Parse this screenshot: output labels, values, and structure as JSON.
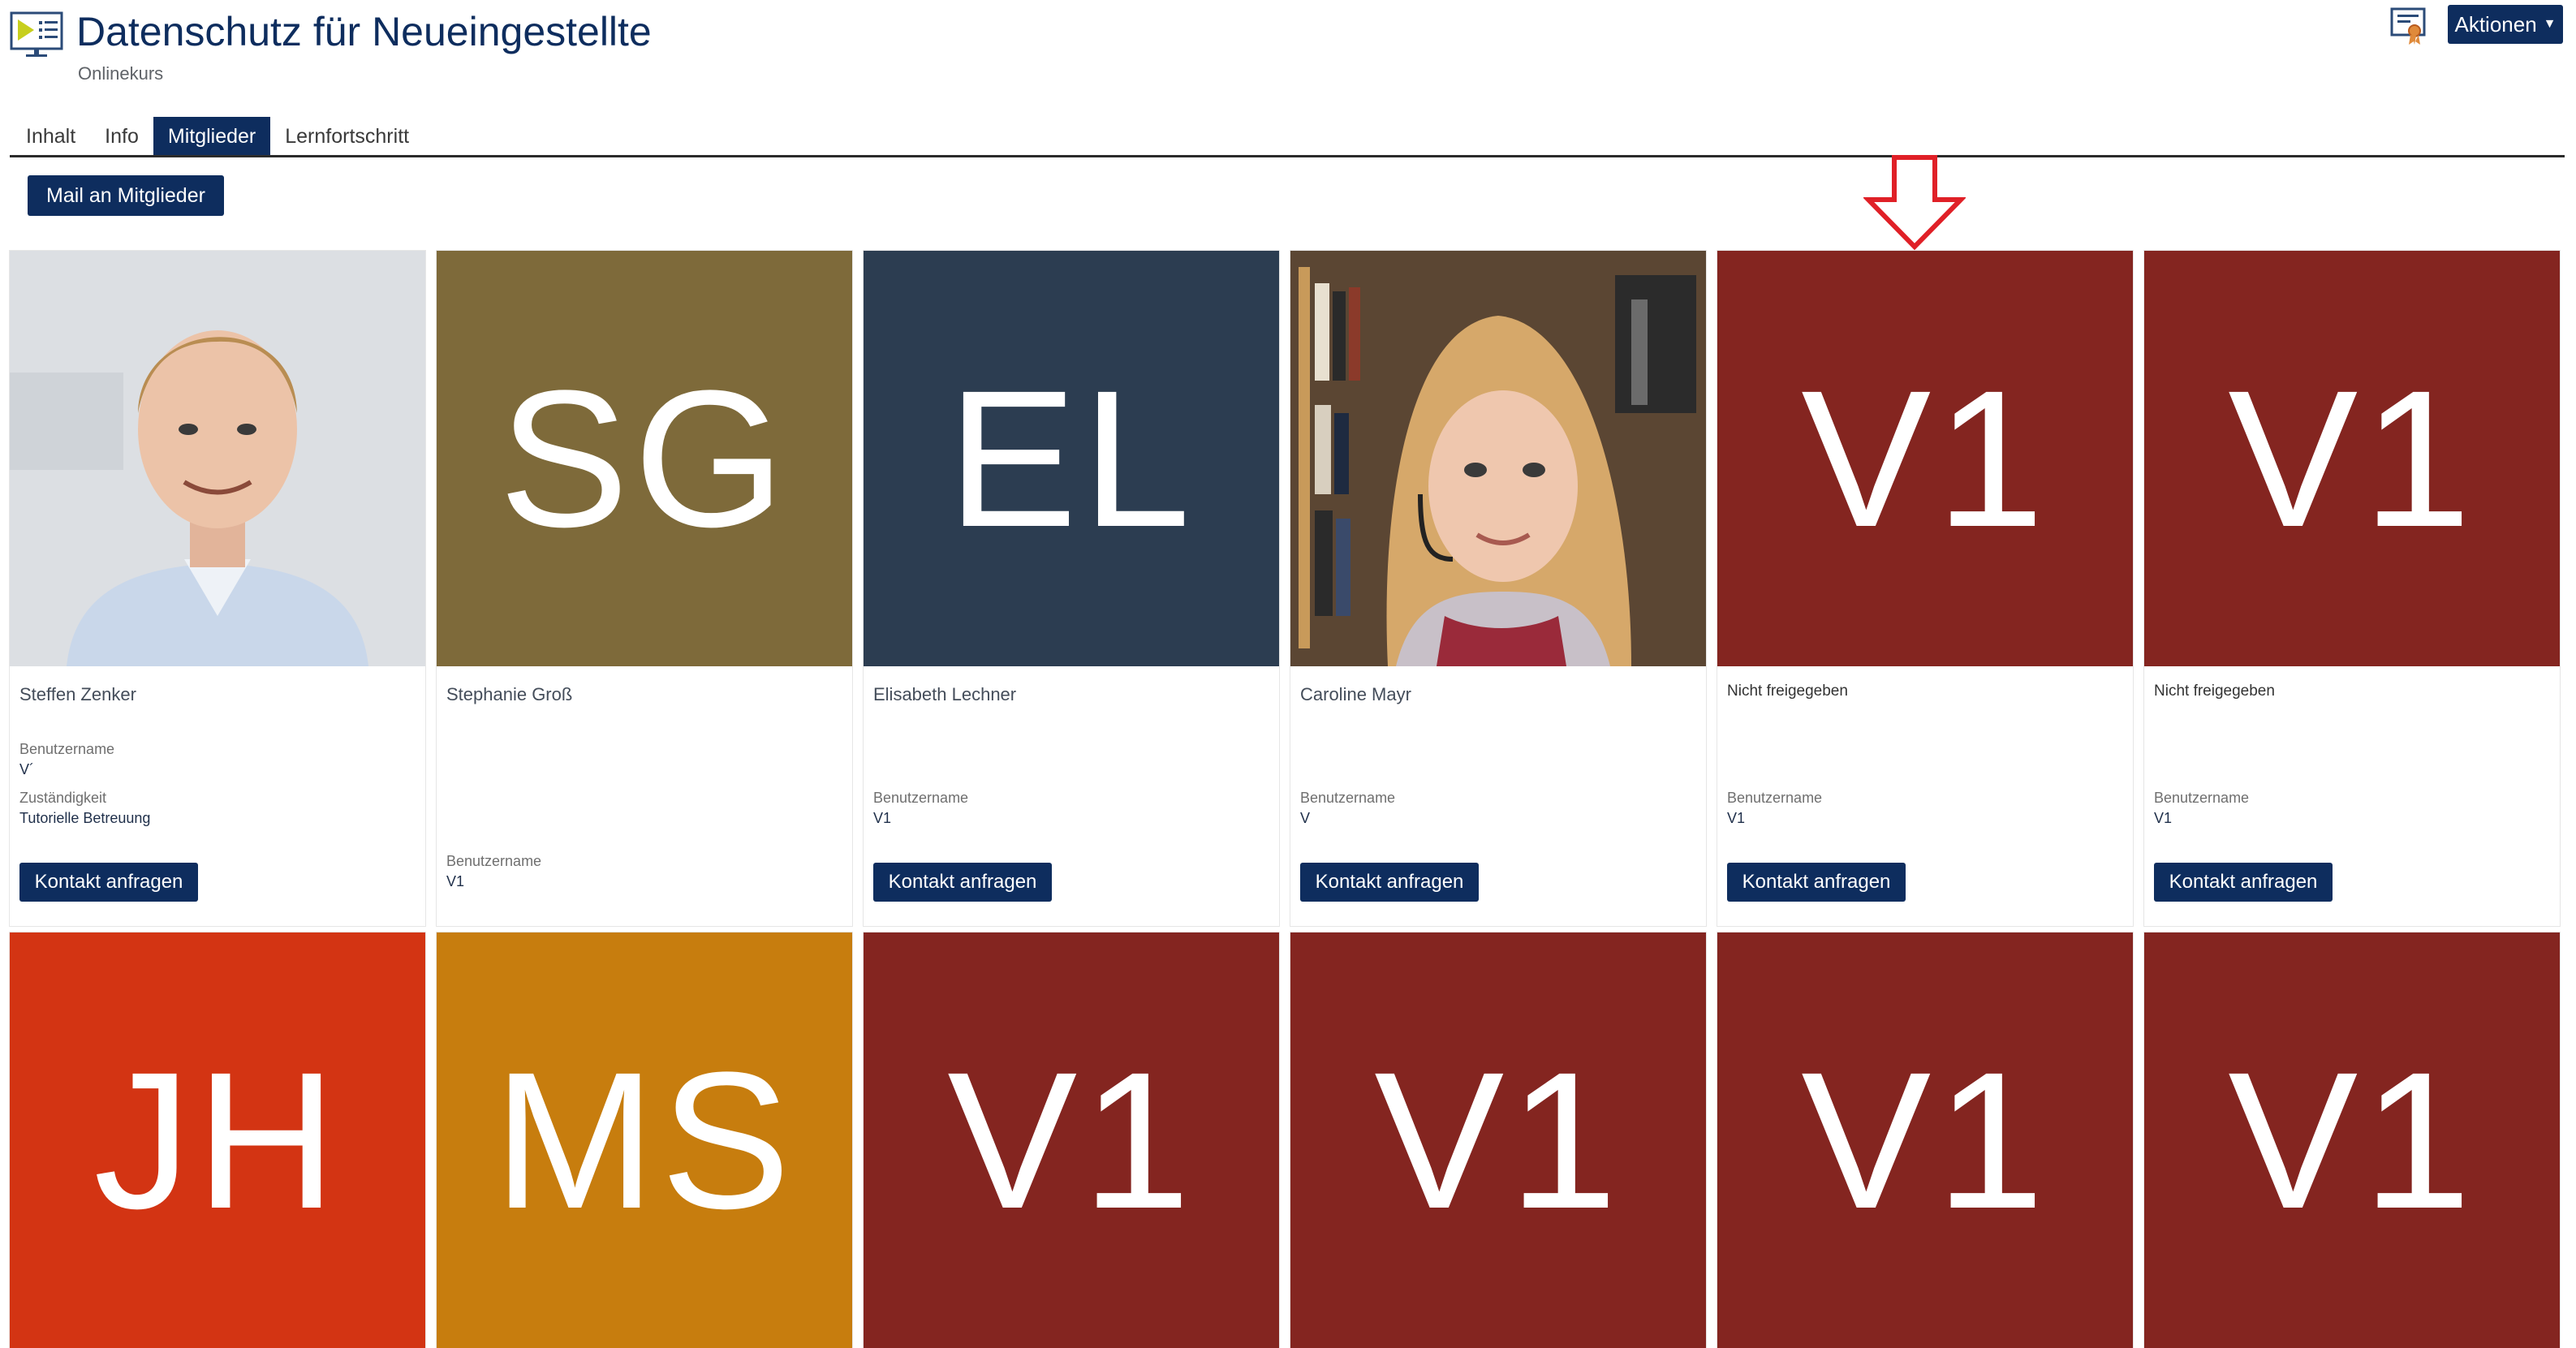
{
  "header": {
    "title": "Datenschutz für Neueingestellte",
    "subtitle": "Onlinekurs",
    "actions_label": "Aktionen",
    "course_icon": "presentation-icon",
    "certificate_icon": "certificate-icon"
  },
  "tabs": [
    {
      "label": "Inhalt",
      "active": false
    },
    {
      "label": "Info",
      "active": false
    },
    {
      "label": "Mitglieder",
      "active": true
    },
    {
      "label": "Lernfortschritt",
      "active": false
    }
  ],
  "mail_button": "Mail an Mitglieder",
  "colors": {
    "primary": "#0e2d5e",
    "annotation_arrow": "#e02027"
  },
  "members_row1": [
    {
      "name": "Steffen Zenker",
      "status": "",
      "photo": true,
      "color": "#dfe3e8",
      "username_label": "Benutzername",
      "username": "V´",
      "responsibility_label": "Zuständigkeit",
      "responsibility": "Tutorielle Betreuung",
      "contact": "Kontakt anfragen"
    },
    {
      "name": "Stephanie Groß",
      "status": "",
      "initials": "SG",
      "color": "#7e6a3a",
      "username_label": "Benutzername",
      "username": "V1",
      "contact": ""
    },
    {
      "name": "Elisabeth Lechner",
      "status": "",
      "initials": "EL",
      "color": "#2c3d51",
      "username_label": "Benutzername",
      "username": "V1",
      "contact": "Kontakt anfragen"
    },
    {
      "name": "Caroline Mayr",
      "status": "",
      "photo": true,
      "color": "#6b5a45",
      "username_label": "Benutzername",
      "username": "V",
      "contact": "Kontakt anfragen"
    },
    {
      "name": "",
      "status": "Nicht freigegeben",
      "initials": "V1",
      "color": "#842520",
      "username_label": "Benutzername",
      "username": "V1",
      "contact": "Kontakt anfragen"
    },
    {
      "name": "",
      "status": "Nicht freigegeben",
      "initials": "V1",
      "color": "#842520",
      "username_label": "Benutzername",
      "username": "V1",
      "contact": "Kontakt anfragen"
    }
  ],
  "members_row2": [
    {
      "initials": "JH",
      "color": "#d33413"
    },
    {
      "initials": "MS",
      "color": "#c77d0e"
    },
    {
      "initials": "V1",
      "color": "#842520"
    },
    {
      "initials": "V1",
      "color": "#842520"
    },
    {
      "initials": "V1",
      "color": "#842520"
    },
    {
      "initials": "V1",
      "color": "#842520"
    }
  ]
}
